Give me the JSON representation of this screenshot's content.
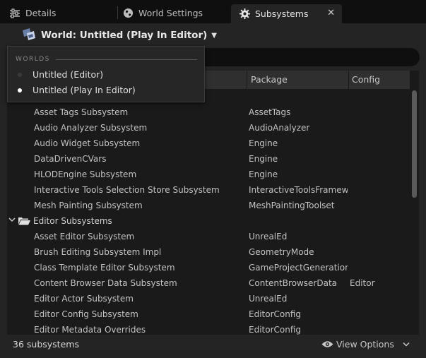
{
  "tabs": [
    {
      "label": "Details",
      "icon": "sliders-icon"
    },
    {
      "label": "World Settings",
      "icon": "globe-icon"
    },
    {
      "label": "Subsystems",
      "icon": "gear-icon",
      "active": true
    }
  ],
  "world_selector": {
    "label": "World: Untitled (Play In Editor)"
  },
  "dropdown": {
    "heading": "WORLDS",
    "items": [
      {
        "label": "Untitled (Editor)",
        "selected": false
      },
      {
        "label": "Untitled (Play In Editor)",
        "selected": true
      }
    ]
  },
  "table": {
    "columns": [
      "Package",
      "Config"
    ],
    "rows": [
      {
        "name": "Asset Tags Subsystem",
        "package": "AssetTags",
        "config": ""
      },
      {
        "name": "Audio Analyzer Subsystem",
        "package": "AudioAnalyzer",
        "config": ""
      },
      {
        "name": "Audio Widget Subsystem",
        "package": "Engine",
        "config": ""
      },
      {
        "name": "DataDrivenCVars",
        "package": "Engine",
        "config": ""
      },
      {
        "name": "HLODEngine Subsystem",
        "package": "Engine",
        "config": ""
      },
      {
        "name": "Interactive Tools Selection Store Subsystem",
        "package": "InteractiveToolsFrameworl",
        "config": ""
      },
      {
        "name": "Mesh Painting Subsystem",
        "package": "MeshPaintingToolset",
        "config": ""
      }
    ],
    "category": {
      "name": "Editor Subsystems"
    },
    "editor_rows": [
      {
        "name": "Asset Editor Subsystem",
        "package": "UnrealEd",
        "config": ""
      },
      {
        "name": "Brush Editing Subsystem Impl",
        "package": "GeometryMode",
        "config": ""
      },
      {
        "name": "Class Template Editor Subsystem",
        "package": "GameProjectGeneration",
        "config": ""
      },
      {
        "name": "Content Browser Data Subsystem",
        "package": "ContentBrowserData",
        "config": "Editor"
      },
      {
        "name": "Editor Actor Subsystem",
        "package": "UnrealEd",
        "config": ""
      },
      {
        "name": "Editor Config Subsystem",
        "package": "EditorConfig",
        "config": ""
      },
      {
        "name": "Editor Metadata Overrides",
        "package": "EditorConfig",
        "config": ""
      }
    ]
  },
  "footer": {
    "count": "36 subsystems",
    "view_options": "View Options"
  },
  "colors": {
    "background": "#242424",
    "tab_bar": "#0f0f0f",
    "selected_dot": "#ffffff",
    "unselected_dot": "#3a3a3a"
  }
}
